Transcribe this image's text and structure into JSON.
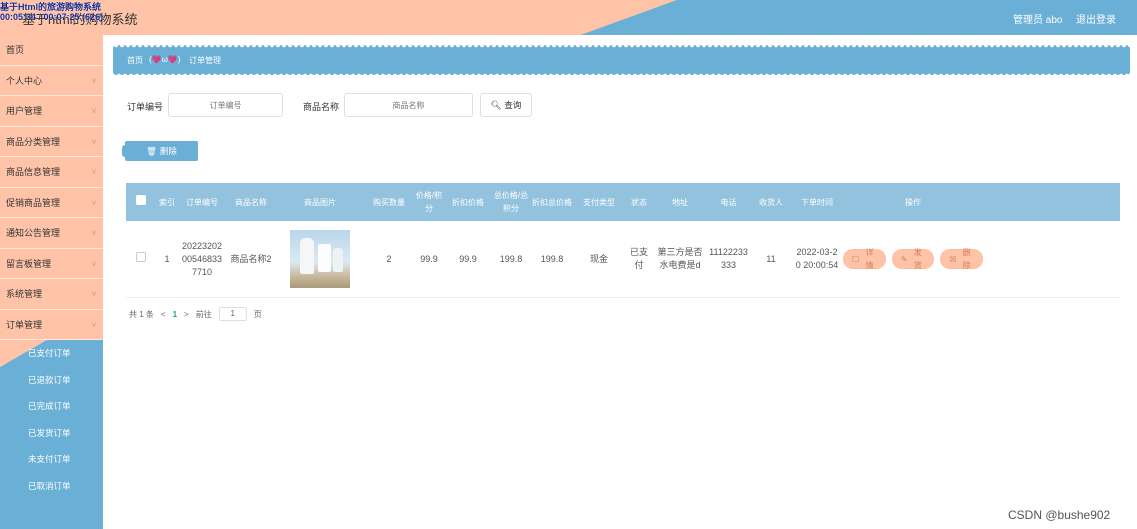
{
  "header": {
    "overlay_lines": [
      "基于Html的旅游购物系统",
      "00:05:34 / 00:07:25 (626)"
    ],
    "title": "基于html的购物系统",
    "admin": "管理员 abo",
    "logout": "退出登录"
  },
  "sidebar": {
    "items": [
      {
        "label": "首页",
        "chevron": false
      },
      {
        "label": "个人中心",
        "chevron": true
      },
      {
        "label": "用户管理",
        "chevron": true
      },
      {
        "label": "商品分类管理",
        "chevron": true
      },
      {
        "label": "商品信息管理",
        "chevron": true
      },
      {
        "label": "促销商品管理",
        "chevron": true
      },
      {
        "label": "通知公告管理",
        "chevron": true
      },
      {
        "label": "留言板管理",
        "chevron": true
      },
      {
        "label": "系统管理",
        "chevron": true
      },
      {
        "label": "订单管理",
        "chevron": true
      }
    ],
    "subitems": [
      "已支付订单",
      "已退款订单",
      "已完成订单",
      "已发货订单",
      "未支付订单",
      "已取消订单"
    ],
    "active_sub": "已退款订单"
  },
  "breadcrumb": {
    "home": "首页",
    "emoji": "(💗ω💗)",
    "current": "订单管理"
  },
  "search": {
    "order_label": "订单编号",
    "order_placeholder": "订单编号",
    "product_label": "商品名称",
    "product_placeholder": "商品名称",
    "query_btn": "查询"
  },
  "toolbar": {
    "delete_btn": "删除"
  },
  "table": {
    "headers": [
      "索引",
      "订单编号",
      "商品名称",
      "商品图片",
      "购买数量",
      "价格/积分",
      "折扣价格",
      "总价格/总积分",
      "折扣总价格",
      "支付类型",
      "状态",
      "地址",
      "电话",
      "收货人",
      "下单时间",
      "操作"
    ],
    "rows": [
      {
        "index": "1",
        "order_no": "2022320200546833 7710",
        "product": "商品名称2",
        "qty": "2",
        "price": "99.9",
        "discount": "99.9",
        "total": "199.8",
        "discount_total": "199.8",
        "pay_type": "现金",
        "status": "已支付",
        "address": "第三方是否水电费是d",
        "phone": "11122233333",
        "receiver": "11",
        "time": "2022-03-20 20:00:54"
      }
    ],
    "ops": [
      "详情",
      "发货",
      "删除"
    ]
  },
  "pager": {
    "total": "共 1 条",
    "prev": "<",
    "page": "1",
    "next": ">",
    "goto": "前往",
    "page_value": "1",
    "page_unit": "页"
  },
  "watermark": "CSDN @bushe902"
}
